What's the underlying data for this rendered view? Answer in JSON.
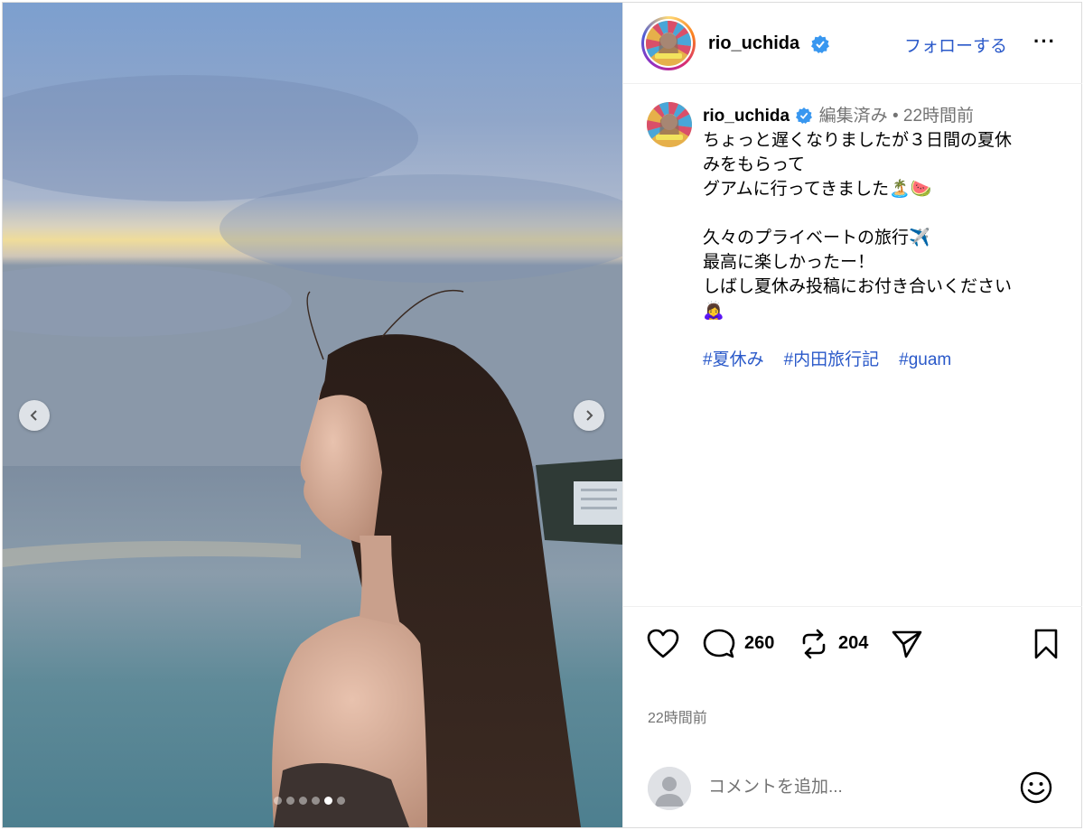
{
  "header": {
    "username": "rio_uchida",
    "follow_label": "フォローする",
    "more_label": "···"
  },
  "caption": {
    "username": "rio_uchida",
    "edited": "編集済み",
    "separator": "•",
    "time_ago": "22時間前",
    "lines": [
      "ちょっと遅くなりましたが３日間の夏休",
      "みをもらって",
      "グアムに行ってきました🏝️🍉",
      "",
      "久々のプライベートの旅行✈️",
      "最高に楽しかったー！",
      "しばし夏休み投稿にお付き合いください",
      "🙇‍♀️"
    ],
    "hashtags": [
      "#夏休み",
      "#内田旅行記",
      "#guam"
    ]
  },
  "actions": {
    "comment_count": "260",
    "repost_count": "204"
  },
  "post_time": "22時間前",
  "comment": {
    "placeholder": "コメントを追加..."
  },
  "carousel": {
    "total": 6,
    "active_index": 4
  },
  "colors": {
    "link_blue": "#2a59c9",
    "verified_blue": "#3897f0",
    "secondary_text": "#737373"
  }
}
